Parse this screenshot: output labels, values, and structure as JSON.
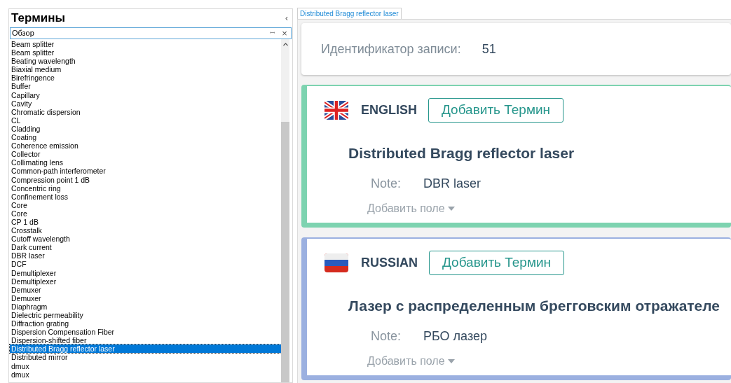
{
  "sidebar": {
    "title": "Термины",
    "collapse_glyph": "‹",
    "search": {
      "value": "Обзор",
      "pin_glyph": "ꟷ",
      "clear_glyph": "×"
    },
    "items": [
      {
        "label": "Beam splitter",
        "selected": false
      },
      {
        "label": "Beam splitter",
        "selected": false
      },
      {
        "label": "Beating wavelength",
        "selected": false
      },
      {
        "label": "Biaxial medium",
        "selected": false
      },
      {
        "label": "Birefringence",
        "selected": false
      },
      {
        "label": "Buffer",
        "selected": false
      },
      {
        "label": "Capillary",
        "selected": false
      },
      {
        "label": "Cavity",
        "selected": false
      },
      {
        "label": "Chromatic dispersion",
        "selected": false
      },
      {
        "label": "CL",
        "selected": false
      },
      {
        "label": "Cladding",
        "selected": false
      },
      {
        "label": "Coating",
        "selected": false
      },
      {
        "label": "Coherence emission",
        "selected": false
      },
      {
        "label": "Collector",
        "selected": false
      },
      {
        "label": "Collimating lens",
        "selected": false
      },
      {
        "label": "Common-path interferometer",
        "selected": false
      },
      {
        "label": "Compression point 1 dB",
        "selected": false
      },
      {
        "label": "Concentric ring",
        "selected": false
      },
      {
        "label": "Confinement loss",
        "selected": false
      },
      {
        "label": "Core",
        "selected": false
      },
      {
        "label": "Core",
        "selected": false
      },
      {
        "label": "CP 1 dB",
        "selected": false
      },
      {
        "label": "Crosstalk",
        "selected": false
      },
      {
        "label": "Cutoff wavelength",
        "selected": false
      },
      {
        "label": "Dark current",
        "selected": false
      },
      {
        "label": "DBR laser",
        "selected": false
      },
      {
        "label": "DCF",
        "selected": false
      },
      {
        "label": "Demultiplexer",
        "selected": false
      },
      {
        "label": "Demultiplexer",
        "selected": false
      },
      {
        "label": "Demuxer",
        "selected": false
      },
      {
        "label": "Demuxer",
        "selected": false
      },
      {
        "label": "Diaphragm",
        "selected": false
      },
      {
        "label": "Dielectric permeability",
        "selected": false
      },
      {
        "label": "Diffraction grating",
        "selected": false
      },
      {
        "label": "Dispersion Compensation Fiber",
        "selected": false
      },
      {
        "label": "Dispersion-shifted fiber",
        "selected": false
      },
      {
        "label": "Distributed Bragg reflector laser",
        "selected": true
      },
      {
        "label": "Distributed mirror",
        "selected": false
      },
      {
        "label": "dmux",
        "selected": false
      },
      {
        "label": "dmux",
        "selected": false
      }
    ]
  },
  "tabs": [
    {
      "label": "Distributed Bragg reflector laser",
      "selected": true
    }
  ],
  "record": {
    "label": "Идентификатор записи:",
    "value": "51"
  },
  "languages": [
    {
      "kind": "gb",
      "name": "ENGLISH",
      "color": "#7dd3b0",
      "add_button": "Добавить Термин",
      "term": "Distributed Bragg reflector laser",
      "note_label": "Note:",
      "note": "DBR laser",
      "add_field": "Добавить поле"
    },
    {
      "kind": "ru",
      "name": "RUSSIAN",
      "color": "#9bb0e0",
      "add_button": "Добавить Термин",
      "term": "Лазер с распределенным брегговским отражателе",
      "note_label": "Note:",
      "note": "РБО лазер",
      "add_field": "Добавить поле"
    }
  ]
}
